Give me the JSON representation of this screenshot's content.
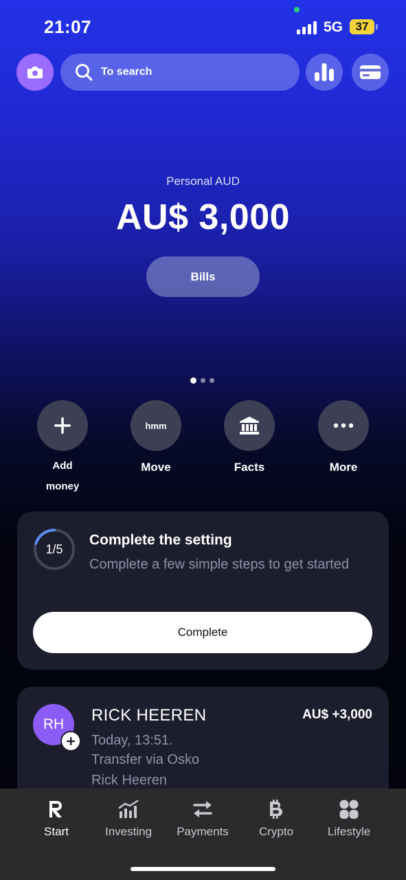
{
  "status_bar": {
    "time": "21:07",
    "network": "5G",
    "battery": "37",
    "battery_color": "#f2d43c"
  },
  "top_bar": {
    "camera_icon": "camera-icon",
    "search_placeholder": "To search",
    "analytics_icon": "bar-chart-icon",
    "cards_icon": "card-icon",
    "camera_color": "#9a6cff"
  },
  "account": {
    "label": "Personal AUD",
    "balance": "AU$ 3,000",
    "bills_label": "Bills",
    "page_count": 3,
    "active_page": 1
  },
  "actions": [
    {
      "label": "Add money",
      "line1": "Add",
      "line2": "money",
      "icon": "plus-icon"
    },
    {
      "label": "Move",
      "icon_text": "hmm",
      "icon": "move-icon"
    },
    {
      "label": "Facts",
      "icon": "bank-icon"
    },
    {
      "label": "More",
      "icon": "more-icon"
    }
  ],
  "setup_card": {
    "progress": "1/5",
    "progress_fraction": 0.2,
    "title": "Complete the setting",
    "subtitle": "Complete a few simple steps to get started",
    "button_label": "Complete",
    "accent_color": "#5b8def"
  },
  "transaction": {
    "initials": "RH",
    "name": "RICK HEEREN",
    "amount": "AU$ +3,000",
    "time": "Today, 13:51.",
    "method": "Transfer via Osko",
    "counterparty": "Rick Heeren",
    "avatar_color": "#8b5cf6"
  },
  "bottom_nav": {
    "items": [
      {
        "label": "Start",
        "icon": "revolut-r-icon",
        "active": true
      },
      {
        "label": "Investing",
        "icon": "investing-icon",
        "active": false
      },
      {
        "label": "Payments",
        "icon": "transfer-arrows-icon",
        "active": false
      },
      {
        "label": "Crypto",
        "icon": "bitcoin-icon",
        "active": false
      },
      {
        "label": "Lifestyle",
        "icon": "lifestyle-icon",
        "active": false
      }
    ]
  }
}
